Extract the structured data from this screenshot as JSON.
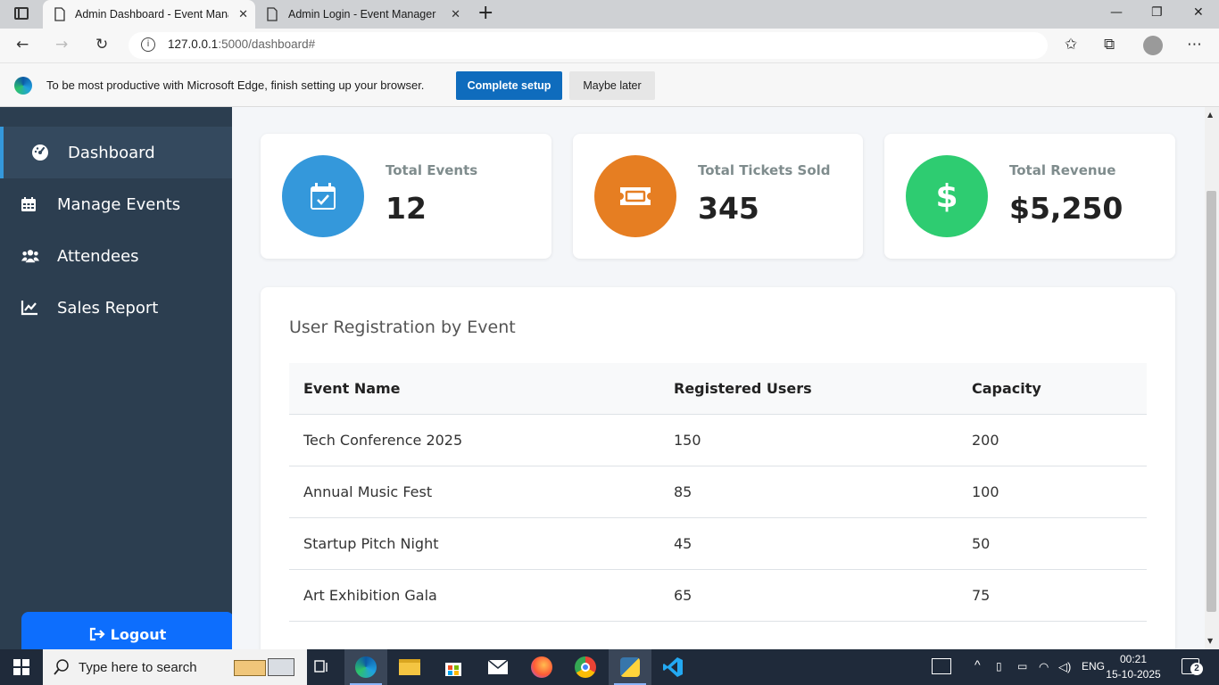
{
  "browser": {
    "tabs": [
      {
        "title": "Admin Dashboard - Event Manag",
        "close": "✕"
      },
      {
        "title": "Admin Login - Event Manager",
        "close": "✕"
      }
    ],
    "new_tab": "+",
    "window_controls": {
      "minimize": "—",
      "restore": "❐",
      "close": "✕"
    },
    "url_host": "127.0.0.1",
    "url_path": ":5000/dashboard#",
    "infobar": {
      "message": "To be most productive with Microsoft Edge, finish setting up your browser.",
      "primary_button": "Complete setup",
      "secondary_button": "Maybe later"
    }
  },
  "sidebar": {
    "items": [
      {
        "label": "Dashboard",
        "icon": "gauge-icon",
        "active": true
      },
      {
        "label": "Manage Events",
        "icon": "calendar-icon",
        "active": false
      },
      {
        "label": "Attendees",
        "icon": "users-icon",
        "active": false
      },
      {
        "label": "Sales Report",
        "icon": "line-chart-icon",
        "active": false
      }
    ],
    "logout_label": "Logout"
  },
  "stats": [
    {
      "label": "Total Events",
      "value": "12",
      "icon": "calendar-check-icon",
      "color": "#3498db"
    },
    {
      "label": "Total Tickets Sold",
      "value": "345",
      "icon": "ticket-icon",
      "color": "#e67e22"
    },
    {
      "label": "Total Revenue",
      "value": "$5,250",
      "icon": "dollar-icon",
      "color": "#2ecc71"
    }
  ],
  "registration_table": {
    "title": "User Registration by Event",
    "columns": [
      "Event Name",
      "Registered Users",
      "Capacity"
    ],
    "rows": [
      [
        "Tech Conference 2025",
        "150",
        "200"
      ],
      [
        "Annual Music Fest",
        "85",
        "100"
      ],
      [
        "Startup Pitch Night",
        "45",
        "50"
      ],
      [
        "Art Exhibition Gala",
        "65",
        "75"
      ]
    ]
  },
  "taskbar": {
    "search_placeholder": "Type here to search",
    "language": "ENG",
    "time": "00:21",
    "date": "15-10-2025",
    "notification_count": "2"
  },
  "colors": {
    "sidebar_bg": "#2c3e50",
    "sidebar_active": "#34495e",
    "accent": "#3498db",
    "logout": "#0d6efd"
  }
}
